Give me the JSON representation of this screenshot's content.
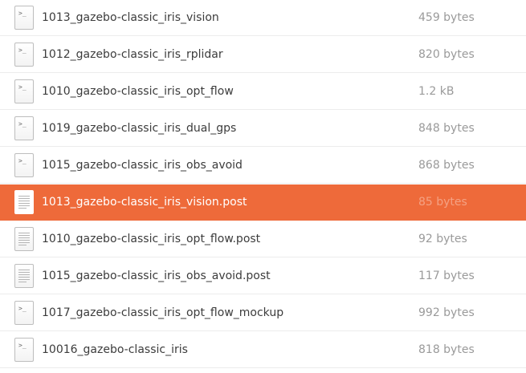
{
  "colors": {
    "selection": "#ee6a3a",
    "name_text": "#3c3c3c",
    "size_text": "#9a9a9a"
  },
  "files": [
    {
      "name": "1013_gazebo-classic_iris_vision",
      "size": "459 bytes",
      "icon": "script-icon",
      "selected": false
    },
    {
      "name": "1012_gazebo-classic_iris_rplidar",
      "size": "820 bytes",
      "icon": "script-icon",
      "selected": false
    },
    {
      "name": "1010_gazebo-classic_iris_opt_flow",
      "size": "1.2 kB",
      "icon": "script-icon",
      "selected": false
    },
    {
      "name": "1019_gazebo-classic_iris_dual_gps",
      "size": "848 bytes",
      "icon": "script-icon",
      "selected": false
    },
    {
      "name": "1015_gazebo-classic_iris_obs_avoid",
      "size": "868 bytes",
      "icon": "script-icon",
      "selected": false
    },
    {
      "name": "1013_gazebo-classic_iris_vision.post",
      "size": "85 bytes",
      "icon": "text-file-icon",
      "selected": true
    },
    {
      "name": "1010_gazebo-classic_iris_opt_flow.post",
      "size": "92 bytes",
      "icon": "text-file-icon",
      "selected": false
    },
    {
      "name": "1015_gazebo-classic_iris_obs_avoid.post",
      "size": "117 bytes",
      "icon": "text-file-icon",
      "selected": false
    },
    {
      "name": "1017_gazebo-classic_iris_opt_flow_mockup",
      "size": "992 bytes",
      "icon": "script-icon",
      "selected": false
    },
    {
      "name": "10016_gazebo-classic_iris",
      "size": "818 bytes",
      "icon": "script-icon",
      "selected": false
    }
  ]
}
